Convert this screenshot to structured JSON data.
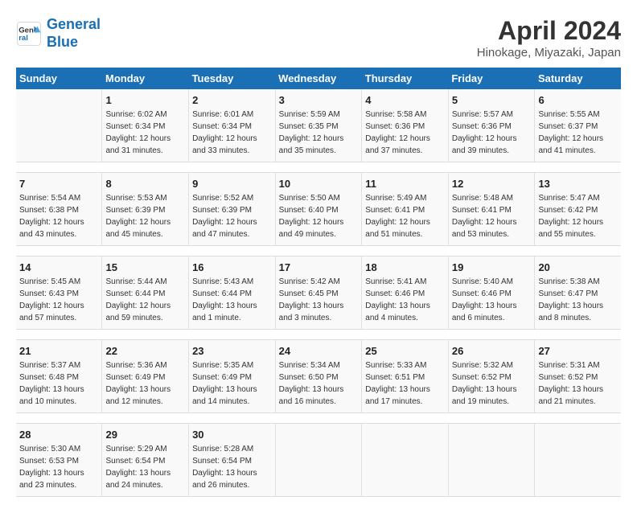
{
  "logo": {
    "line1": "General",
    "line2": "Blue"
  },
  "title": "April 2024",
  "subtitle": "Hinokage, Miyazaki, Japan",
  "days_header": [
    "Sunday",
    "Monday",
    "Tuesday",
    "Wednesday",
    "Thursday",
    "Friday",
    "Saturday"
  ],
  "weeks": [
    [
      {
        "num": "",
        "info": ""
      },
      {
        "num": "1",
        "info": "Sunrise: 6:02 AM\nSunset: 6:34 PM\nDaylight: 12 hours\nand 31 minutes."
      },
      {
        "num": "2",
        "info": "Sunrise: 6:01 AM\nSunset: 6:34 PM\nDaylight: 12 hours\nand 33 minutes."
      },
      {
        "num": "3",
        "info": "Sunrise: 5:59 AM\nSunset: 6:35 PM\nDaylight: 12 hours\nand 35 minutes."
      },
      {
        "num": "4",
        "info": "Sunrise: 5:58 AM\nSunset: 6:36 PM\nDaylight: 12 hours\nand 37 minutes."
      },
      {
        "num": "5",
        "info": "Sunrise: 5:57 AM\nSunset: 6:36 PM\nDaylight: 12 hours\nand 39 minutes."
      },
      {
        "num": "6",
        "info": "Sunrise: 5:55 AM\nSunset: 6:37 PM\nDaylight: 12 hours\nand 41 minutes."
      }
    ],
    [
      {
        "num": "7",
        "info": "Sunrise: 5:54 AM\nSunset: 6:38 PM\nDaylight: 12 hours\nand 43 minutes."
      },
      {
        "num": "8",
        "info": "Sunrise: 5:53 AM\nSunset: 6:39 PM\nDaylight: 12 hours\nand 45 minutes."
      },
      {
        "num": "9",
        "info": "Sunrise: 5:52 AM\nSunset: 6:39 PM\nDaylight: 12 hours\nand 47 minutes."
      },
      {
        "num": "10",
        "info": "Sunrise: 5:50 AM\nSunset: 6:40 PM\nDaylight: 12 hours\nand 49 minutes."
      },
      {
        "num": "11",
        "info": "Sunrise: 5:49 AM\nSunset: 6:41 PM\nDaylight: 12 hours\nand 51 minutes."
      },
      {
        "num": "12",
        "info": "Sunrise: 5:48 AM\nSunset: 6:41 PM\nDaylight: 12 hours\nand 53 minutes."
      },
      {
        "num": "13",
        "info": "Sunrise: 5:47 AM\nSunset: 6:42 PM\nDaylight: 12 hours\nand 55 minutes."
      }
    ],
    [
      {
        "num": "14",
        "info": "Sunrise: 5:45 AM\nSunset: 6:43 PM\nDaylight: 12 hours\nand 57 minutes."
      },
      {
        "num": "15",
        "info": "Sunrise: 5:44 AM\nSunset: 6:44 PM\nDaylight: 12 hours\nand 59 minutes."
      },
      {
        "num": "16",
        "info": "Sunrise: 5:43 AM\nSunset: 6:44 PM\nDaylight: 13 hours\nand 1 minute."
      },
      {
        "num": "17",
        "info": "Sunrise: 5:42 AM\nSunset: 6:45 PM\nDaylight: 13 hours\nand 3 minutes."
      },
      {
        "num": "18",
        "info": "Sunrise: 5:41 AM\nSunset: 6:46 PM\nDaylight: 13 hours\nand 4 minutes."
      },
      {
        "num": "19",
        "info": "Sunrise: 5:40 AM\nSunset: 6:46 PM\nDaylight: 13 hours\nand 6 minutes."
      },
      {
        "num": "20",
        "info": "Sunrise: 5:38 AM\nSunset: 6:47 PM\nDaylight: 13 hours\nand 8 minutes."
      }
    ],
    [
      {
        "num": "21",
        "info": "Sunrise: 5:37 AM\nSunset: 6:48 PM\nDaylight: 13 hours\nand 10 minutes."
      },
      {
        "num": "22",
        "info": "Sunrise: 5:36 AM\nSunset: 6:49 PM\nDaylight: 13 hours\nand 12 minutes."
      },
      {
        "num": "23",
        "info": "Sunrise: 5:35 AM\nSunset: 6:49 PM\nDaylight: 13 hours\nand 14 minutes."
      },
      {
        "num": "24",
        "info": "Sunrise: 5:34 AM\nSunset: 6:50 PM\nDaylight: 13 hours\nand 16 minutes."
      },
      {
        "num": "25",
        "info": "Sunrise: 5:33 AM\nSunset: 6:51 PM\nDaylight: 13 hours\nand 17 minutes."
      },
      {
        "num": "26",
        "info": "Sunrise: 5:32 AM\nSunset: 6:52 PM\nDaylight: 13 hours\nand 19 minutes."
      },
      {
        "num": "27",
        "info": "Sunrise: 5:31 AM\nSunset: 6:52 PM\nDaylight: 13 hours\nand 21 minutes."
      }
    ],
    [
      {
        "num": "28",
        "info": "Sunrise: 5:30 AM\nSunset: 6:53 PM\nDaylight: 13 hours\nand 23 minutes."
      },
      {
        "num": "29",
        "info": "Sunrise: 5:29 AM\nSunset: 6:54 PM\nDaylight: 13 hours\nand 24 minutes."
      },
      {
        "num": "30",
        "info": "Sunrise: 5:28 AM\nSunset: 6:54 PM\nDaylight: 13 hours\nand 26 minutes."
      },
      {
        "num": "",
        "info": ""
      },
      {
        "num": "",
        "info": ""
      },
      {
        "num": "",
        "info": ""
      },
      {
        "num": "",
        "info": ""
      }
    ]
  ]
}
